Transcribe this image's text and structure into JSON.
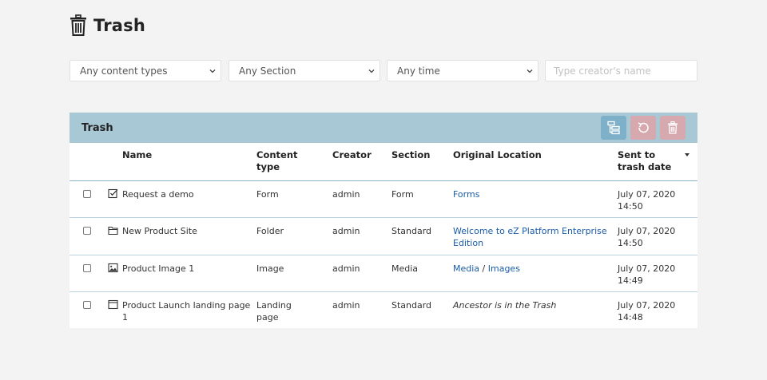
{
  "page": {
    "title": "Trash"
  },
  "filters": {
    "content_type": "Any content types",
    "section": "Any Section",
    "time": "Any time",
    "creator_placeholder": "Type creator's name"
  },
  "panel": {
    "title": "Trash",
    "columns": {
      "name": "Name",
      "content_type": "Content type",
      "creator": "Creator",
      "section": "Section",
      "original_location": "Original Location",
      "sent_date": "Sent to trash date"
    },
    "rows": [
      {
        "icon": "form-icon",
        "name": "Request a demo",
        "content_type": "Form",
        "creator": "admin",
        "section": "Form",
        "location": [
          "Forms"
        ],
        "location_italic": false,
        "date": "July 07, 2020",
        "time": "14:50"
      },
      {
        "icon": "folder-icon",
        "name": "New Product Site",
        "content_type": "Folder",
        "creator": "admin",
        "section": "Standard",
        "location": [
          "Welcome to eZ Platform Enterprise Edition"
        ],
        "location_italic": false,
        "date": "July 07, 2020",
        "time": "14:50"
      },
      {
        "icon": "image-icon",
        "name": "Product Image 1",
        "content_type": "Image",
        "creator": "admin",
        "section": "Media",
        "location": [
          "Media",
          "Images"
        ],
        "location_italic": false,
        "date": "July 07, 2020",
        "time": "14:49"
      },
      {
        "icon": "landing-page-icon",
        "name": "Product Launch landing page 1",
        "content_type": "Landing page",
        "creator": "admin",
        "section": "Standard",
        "location_text": "Ancestor is in the Trash",
        "location_italic": true,
        "date": "July 07, 2020",
        "time": "14:48"
      }
    ]
  },
  "colors": {
    "header_bg": "#a9c8d6",
    "link": "#1a5ca8",
    "restore_btn": "#d5a9ad",
    "tree_btn": "#7fb0c9"
  }
}
